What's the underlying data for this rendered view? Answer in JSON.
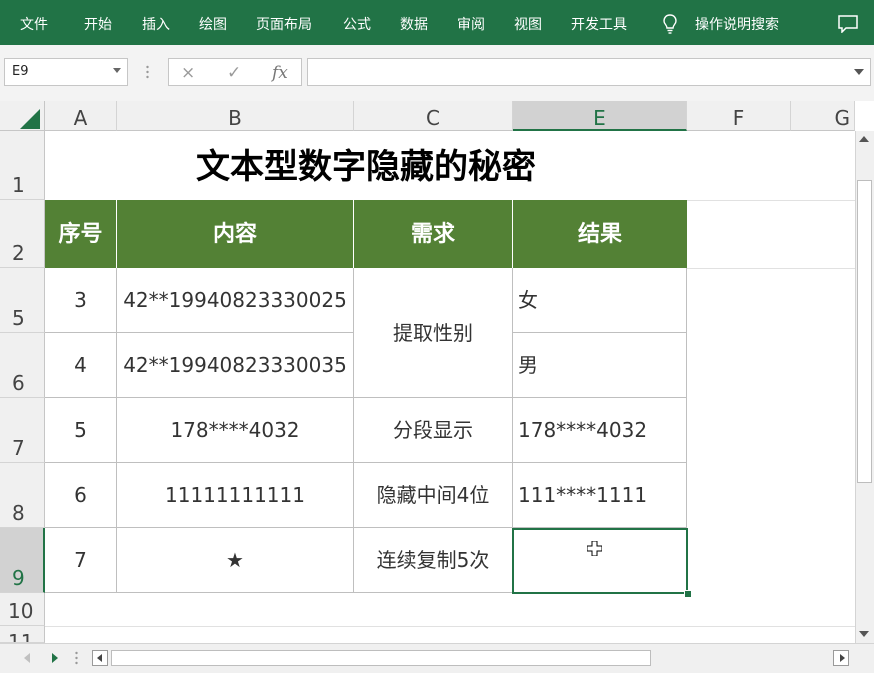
{
  "ribbon": {
    "tabs": [
      "文件",
      "开始",
      "插入",
      "绘图",
      "页面布局",
      "公式",
      "数据",
      "审阅",
      "视图",
      "开发工具"
    ],
    "tell_me": "操作说明搜索",
    "bg_color": "#217346"
  },
  "formula_bar": {
    "name_box": "E9",
    "cancel_icon": "×",
    "enter_icon": "✓",
    "fx_label": "fx",
    "formula": ""
  },
  "columns": [
    "A",
    "B",
    "C",
    "D",
    "E",
    "F",
    "G"
  ],
  "rows": [
    "1",
    "2",
    "5",
    "6",
    "7",
    "8",
    "9",
    "10",
    "11"
  ],
  "sheet": {
    "title": "文本型数字隐藏的秘密",
    "header": {
      "seq": "序号",
      "content": "内容",
      "need": "需求",
      "result": "结果",
      "bg_color": "#538135"
    },
    "data": [
      {
        "seq": "3",
        "content": "42**19940823330025",
        "result": "女"
      },
      {
        "seq": "4",
        "content": "42**19940823330035",
        "result": "男"
      },
      {
        "seq": "5",
        "content": "178****4032",
        "need": "分段显示",
        "result": "178****4032"
      },
      {
        "seq": "6",
        "content": "11111111111",
        "need": "隐藏中间4位",
        "result": "111****1111"
      },
      {
        "seq": "7",
        "content": "★",
        "need": "连续复制5次",
        "result": ""
      }
    ],
    "merged_need": "提取性别"
  },
  "selection": {
    "cell": "E9",
    "color": "#217346"
  }
}
